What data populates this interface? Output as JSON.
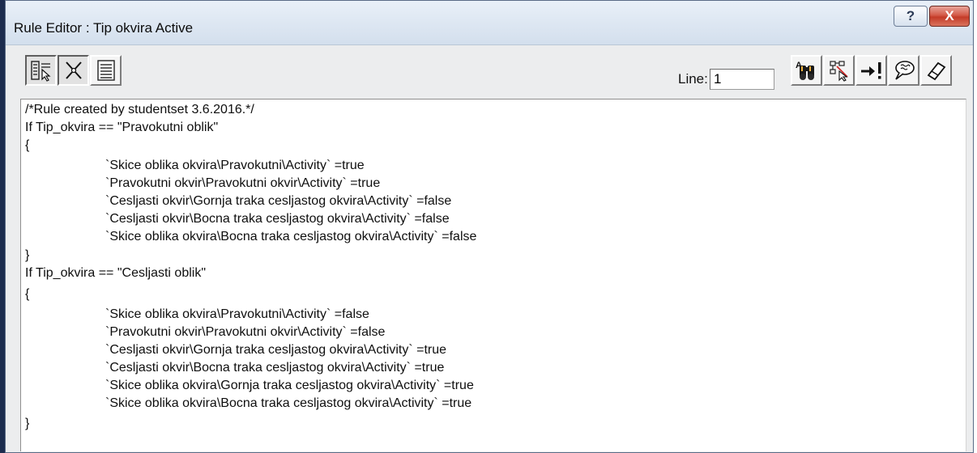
{
  "window": {
    "title": "Rule Editor : Tip okvira Active",
    "help_label": "?",
    "close_label": "X"
  },
  "toolbar": {
    "left_buttons": [
      "rule-browser-icon",
      "cross-icon",
      "text-lines-icon"
    ],
    "right_buttons": [
      "binoculars-icon",
      "tree-select-icon",
      "arrow-exclaim-icon",
      "speech-bubble-icon",
      "eraser-icon"
    ],
    "line_label": "Line:",
    "line_value": "1"
  },
  "editor": {
    "lines": [
      "/*Rule created by studentset 3.6.2016.*/",
      "If Tip_okvira == \"Pravokutni oblik\"",
      "{",
      "`Skice oblika okvira\\Pravokutni\\Activity` =true",
      "`Pravokutni okvir\\Pravokutni okvir\\Activity` =true",
      "`Cesljasti okvir\\Gornja traka cesljastog okvira\\Activity` =false",
      "`Cesljasti okvir\\Bocna traka cesljastog okvira\\Activity` =false",
      "`Skice oblika okvira\\Bocna traka cesljastog okvira\\Activity` =false",
      "}",
      "If Tip_okvira == \"Cesljasti oblik\"",
      "{",
      "`Skice oblika okvira\\Pravokutni\\Activity` =false",
      "`Pravokutni okvir\\Pravokutni okvir\\Activity` =false",
      "`Cesljasti okvir\\Gornja traka cesljastog okvira\\Activity` =true",
      "`Cesljasti okvir\\Bocna traka cesljastog okvira\\Activity` =true",
      "`Skice oblika okvira\\Gornja traka cesljastog okvira\\Activity` =true",
      "`Skice oblika okvira\\Bocna traka cesljastog okvira\\Activity` =true",
      "}"
    ]
  },
  "colors": {
    "title_bar": "#dfe8f3",
    "close_button": "#c43b28",
    "window_bg": "#ecedee",
    "editor_bg": "#ffffff"
  }
}
